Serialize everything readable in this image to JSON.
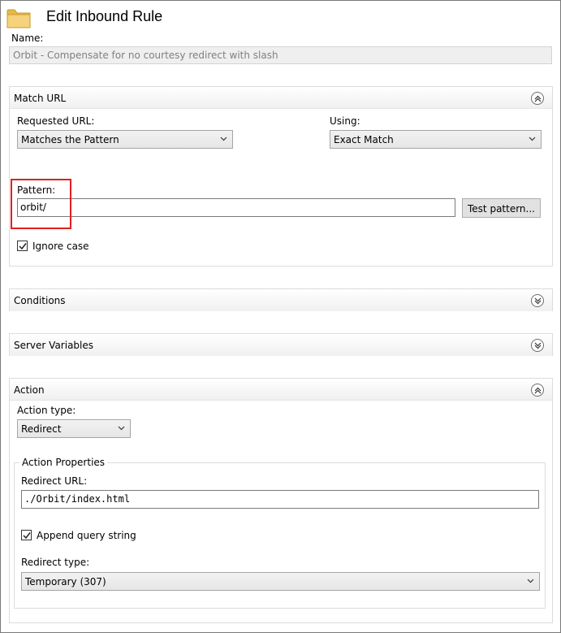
{
  "dialog": {
    "title": "Edit Inbound Rule",
    "name_label": "Name:",
    "name_value": "Orbit - Compensate for no courtesy redirect with slash"
  },
  "match_url": {
    "title": "Match URL",
    "requested_url_label": "Requested URL:",
    "requested_url_value": "Matches the Pattern",
    "using_label": "Using:",
    "using_value": "Exact Match",
    "pattern_label": "Pattern:",
    "pattern_value": "orbit/",
    "test_button": "Test pattern...",
    "ignore_case_label": "Ignore case",
    "ignore_case_checked": true
  },
  "conditions": {
    "title": "Conditions"
  },
  "server_variables": {
    "title": "Server Variables"
  },
  "action": {
    "title": "Action",
    "type_label": "Action type:",
    "type_value": "Redirect",
    "properties_title": "Action Properties",
    "redirect_url_label": "Redirect URL:",
    "redirect_url_value": "./Orbit/index.html",
    "append_query_label": "Append query string",
    "append_query_checked": true,
    "redirect_type_label": "Redirect type:",
    "redirect_type_value": "Temporary (307)"
  },
  "colors": {
    "highlight": "#e02020",
    "header_bg": "#f0f0f0",
    "disabled_field": "#efefef"
  },
  "icons": [
    "folder-icon",
    "chevron-up-icon",
    "chevron-down-icon",
    "dropdown-arrow-icon",
    "checkmark-icon"
  ]
}
